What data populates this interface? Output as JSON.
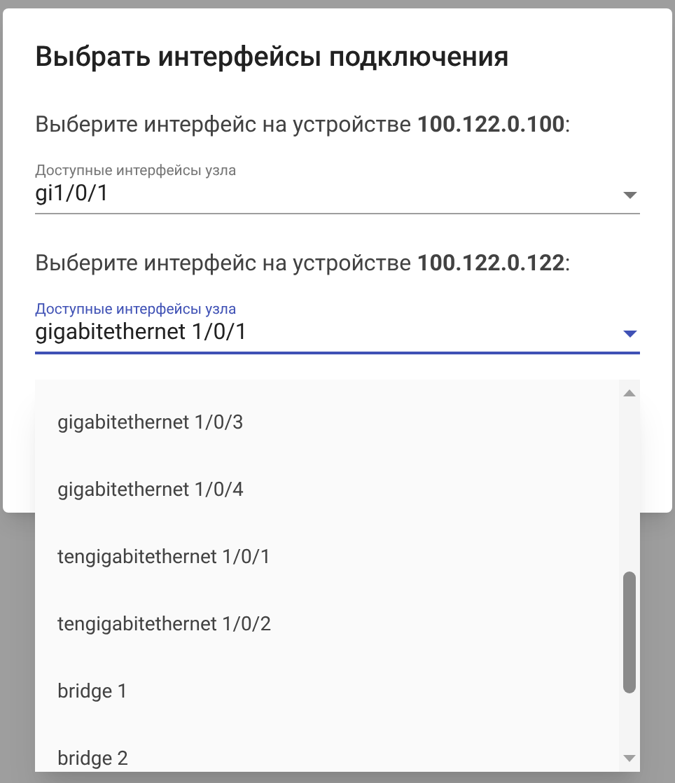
{
  "dialog": {
    "title": "Выбрать интерфейсы подключения",
    "sections": [
      {
        "prompt": "Выберите интерфейс на устройстве **100.122.0.100**:",
        "select": {
          "label": "Доступные интерфейсы узла",
          "value": "gi1/0/1",
          "focused": false
        }
      },
      {
        "prompt": "Выберите интерфейс на устройстве **100.122.0.122**:",
        "select": {
          "label": "Доступные интерфейсы узла",
          "value": "gigabitethernet 1/0/1",
          "focused": true
        }
      }
    ]
  },
  "dropdown": {
    "options": [
      {
        "label": "gigabitethernet 1/0/3",
        "selected": false
      },
      {
        "label": "gigabitethernet 1/0/4",
        "selected": false
      },
      {
        "label": "tengigabitethernet 1/0/1",
        "selected": false
      },
      {
        "label": "tengigabitethernet 1/0/2",
        "selected": false
      },
      {
        "label": "bridge 1",
        "selected": false
      },
      {
        "label": "bridge 2",
        "selected": false
      }
    ]
  }
}
